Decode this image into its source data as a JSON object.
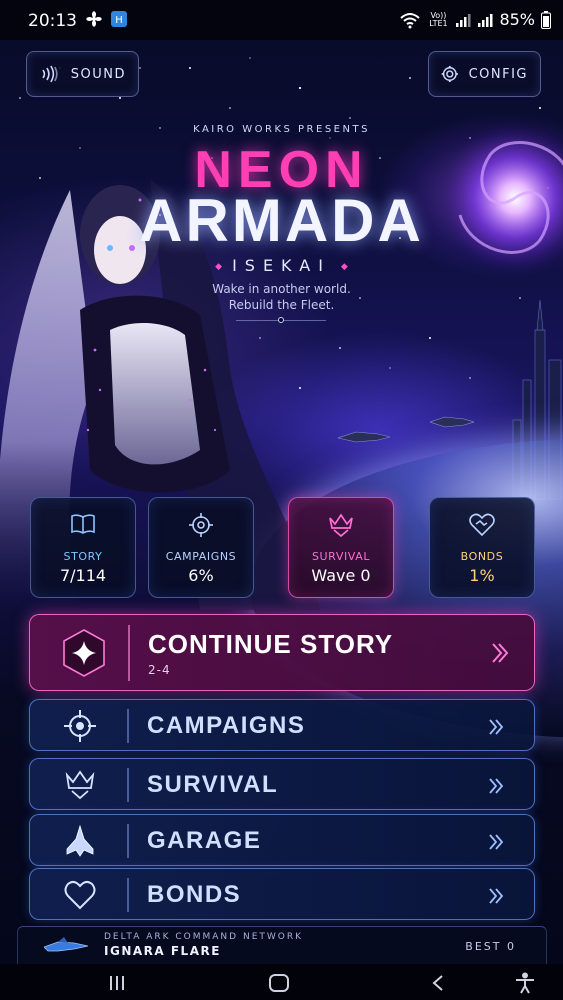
{
  "status_bar": {
    "time": "20:13",
    "network_label": "Vo)) LTE1",
    "battery": "85%",
    "icons": [
      "fan-icon",
      "app-icon",
      "wifi-icon",
      "signal-icon",
      "battery-icon"
    ]
  },
  "top_buttons": {
    "sound_label": "SOUND",
    "config_label": "CONFIG"
  },
  "title": {
    "presents": "KAIRO WORKS PRESENTS",
    "line1": "NEON",
    "line2": "ARMADA",
    "subtitle": "ISEKAI",
    "tagline1": "Wake in another world.",
    "tagline2": "Rebuild the Fleet."
  },
  "stats": [
    {
      "label": "STORY",
      "value": "7/114",
      "icon": "book-icon",
      "label_color": "#7fc7ff",
      "value_color": "#ffffff"
    },
    {
      "label": "CAMPAIGNS",
      "value": "6%",
      "icon": "target-icon",
      "label_color": "#b9d2ff",
      "value_color": "#ffffff"
    },
    {
      "label": "SURVIVAL",
      "value": "Wave 0",
      "icon": "crown-chevron-icon",
      "label_color": "#ff6fd0",
      "value_color": "#ffffff"
    },
    {
      "label": "BONDS",
      "value": "1%",
      "icon": "heart-handshake-icon",
      "label_color": "#ffd27a",
      "value_color": "#ffd27a"
    }
  ],
  "menu": {
    "continue": {
      "title": "CONTINUE STORY",
      "sub": "2-4"
    },
    "items": [
      {
        "label": "CAMPAIGNS",
        "icon": "crosshair-icon"
      },
      {
        "label": "SURVIVAL",
        "icon": "crown-chevron-icon"
      },
      {
        "label": "GARAGE",
        "icon": "jet-icon"
      },
      {
        "label": "BONDS",
        "icon": "heart-icon"
      }
    ]
  },
  "footer": {
    "network": "DELTA ARK COMMAND NETWORK",
    "pilot": "IGNARA FLARE",
    "best": "BEST 0"
  },
  "colors": {
    "accent_pink": "#ff3fb3",
    "accent_blue": "#6fa8ff",
    "background": "#05071a"
  }
}
